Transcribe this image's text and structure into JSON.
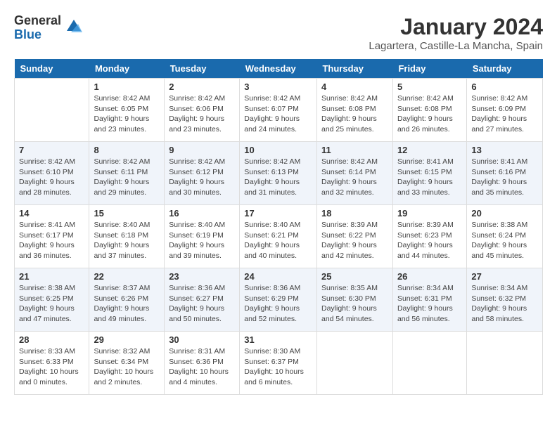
{
  "logo": {
    "general": "General",
    "blue": "Blue"
  },
  "title": {
    "month_year": "January 2024",
    "location": "Lagartera, Castille-La Mancha, Spain"
  },
  "weekdays": [
    "Sunday",
    "Monday",
    "Tuesday",
    "Wednesday",
    "Thursday",
    "Friday",
    "Saturday"
  ],
  "weeks": [
    [
      {
        "day": "",
        "sunrise": "",
        "sunset": "",
        "daylight": ""
      },
      {
        "day": "1",
        "sunrise": "Sunrise: 8:42 AM",
        "sunset": "Sunset: 6:05 PM",
        "daylight": "Daylight: 9 hours and 23 minutes."
      },
      {
        "day": "2",
        "sunrise": "Sunrise: 8:42 AM",
        "sunset": "Sunset: 6:06 PM",
        "daylight": "Daylight: 9 hours and 23 minutes."
      },
      {
        "day": "3",
        "sunrise": "Sunrise: 8:42 AM",
        "sunset": "Sunset: 6:07 PM",
        "daylight": "Daylight: 9 hours and 24 minutes."
      },
      {
        "day": "4",
        "sunrise": "Sunrise: 8:42 AM",
        "sunset": "Sunset: 6:08 PM",
        "daylight": "Daylight: 9 hours and 25 minutes."
      },
      {
        "day": "5",
        "sunrise": "Sunrise: 8:42 AM",
        "sunset": "Sunset: 6:08 PM",
        "daylight": "Daylight: 9 hours and 26 minutes."
      },
      {
        "day": "6",
        "sunrise": "Sunrise: 8:42 AM",
        "sunset": "Sunset: 6:09 PM",
        "daylight": "Daylight: 9 hours and 27 minutes."
      }
    ],
    [
      {
        "day": "7",
        "sunrise": "Sunrise: 8:42 AM",
        "sunset": "Sunset: 6:10 PM",
        "daylight": "Daylight: 9 hours and 28 minutes."
      },
      {
        "day": "8",
        "sunrise": "Sunrise: 8:42 AM",
        "sunset": "Sunset: 6:11 PM",
        "daylight": "Daylight: 9 hours and 29 minutes."
      },
      {
        "day": "9",
        "sunrise": "Sunrise: 8:42 AM",
        "sunset": "Sunset: 6:12 PM",
        "daylight": "Daylight: 9 hours and 30 minutes."
      },
      {
        "day": "10",
        "sunrise": "Sunrise: 8:42 AM",
        "sunset": "Sunset: 6:13 PM",
        "daylight": "Daylight: 9 hours and 31 minutes."
      },
      {
        "day": "11",
        "sunrise": "Sunrise: 8:42 AM",
        "sunset": "Sunset: 6:14 PM",
        "daylight": "Daylight: 9 hours and 32 minutes."
      },
      {
        "day": "12",
        "sunrise": "Sunrise: 8:41 AM",
        "sunset": "Sunset: 6:15 PM",
        "daylight": "Daylight: 9 hours and 33 minutes."
      },
      {
        "day": "13",
        "sunrise": "Sunrise: 8:41 AM",
        "sunset": "Sunset: 6:16 PM",
        "daylight": "Daylight: 9 hours and 35 minutes."
      }
    ],
    [
      {
        "day": "14",
        "sunrise": "Sunrise: 8:41 AM",
        "sunset": "Sunset: 6:17 PM",
        "daylight": "Daylight: 9 hours and 36 minutes."
      },
      {
        "day": "15",
        "sunrise": "Sunrise: 8:40 AM",
        "sunset": "Sunset: 6:18 PM",
        "daylight": "Daylight: 9 hours and 37 minutes."
      },
      {
        "day": "16",
        "sunrise": "Sunrise: 8:40 AM",
        "sunset": "Sunset: 6:19 PM",
        "daylight": "Daylight: 9 hours and 39 minutes."
      },
      {
        "day": "17",
        "sunrise": "Sunrise: 8:40 AM",
        "sunset": "Sunset: 6:21 PM",
        "daylight": "Daylight: 9 hours and 40 minutes."
      },
      {
        "day": "18",
        "sunrise": "Sunrise: 8:39 AM",
        "sunset": "Sunset: 6:22 PM",
        "daylight": "Daylight: 9 hours and 42 minutes."
      },
      {
        "day": "19",
        "sunrise": "Sunrise: 8:39 AM",
        "sunset": "Sunset: 6:23 PM",
        "daylight": "Daylight: 9 hours and 44 minutes."
      },
      {
        "day": "20",
        "sunrise": "Sunrise: 8:38 AM",
        "sunset": "Sunset: 6:24 PM",
        "daylight": "Daylight: 9 hours and 45 minutes."
      }
    ],
    [
      {
        "day": "21",
        "sunrise": "Sunrise: 8:38 AM",
        "sunset": "Sunset: 6:25 PM",
        "daylight": "Daylight: 9 hours and 47 minutes."
      },
      {
        "day": "22",
        "sunrise": "Sunrise: 8:37 AM",
        "sunset": "Sunset: 6:26 PM",
        "daylight": "Daylight: 9 hours and 49 minutes."
      },
      {
        "day": "23",
        "sunrise": "Sunrise: 8:36 AM",
        "sunset": "Sunset: 6:27 PM",
        "daylight": "Daylight: 9 hours and 50 minutes."
      },
      {
        "day": "24",
        "sunrise": "Sunrise: 8:36 AM",
        "sunset": "Sunset: 6:29 PM",
        "daylight": "Daylight: 9 hours and 52 minutes."
      },
      {
        "day": "25",
        "sunrise": "Sunrise: 8:35 AM",
        "sunset": "Sunset: 6:30 PM",
        "daylight": "Daylight: 9 hours and 54 minutes."
      },
      {
        "day": "26",
        "sunrise": "Sunrise: 8:34 AM",
        "sunset": "Sunset: 6:31 PM",
        "daylight": "Daylight: 9 hours and 56 minutes."
      },
      {
        "day": "27",
        "sunrise": "Sunrise: 8:34 AM",
        "sunset": "Sunset: 6:32 PM",
        "daylight": "Daylight: 9 hours and 58 minutes."
      }
    ],
    [
      {
        "day": "28",
        "sunrise": "Sunrise: 8:33 AM",
        "sunset": "Sunset: 6:33 PM",
        "daylight": "Daylight: 10 hours and 0 minutes."
      },
      {
        "day": "29",
        "sunrise": "Sunrise: 8:32 AM",
        "sunset": "Sunset: 6:34 PM",
        "daylight": "Daylight: 10 hours and 2 minutes."
      },
      {
        "day": "30",
        "sunrise": "Sunrise: 8:31 AM",
        "sunset": "Sunset: 6:36 PM",
        "daylight": "Daylight: 10 hours and 4 minutes."
      },
      {
        "day": "31",
        "sunrise": "Sunrise: 8:30 AM",
        "sunset": "Sunset: 6:37 PM",
        "daylight": "Daylight: 10 hours and 6 minutes."
      },
      {
        "day": "",
        "sunrise": "",
        "sunset": "",
        "daylight": ""
      },
      {
        "day": "",
        "sunrise": "",
        "sunset": "",
        "daylight": ""
      },
      {
        "day": "",
        "sunrise": "",
        "sunset": "",
        "daylight": ""
      }
    ]
  ]
}
